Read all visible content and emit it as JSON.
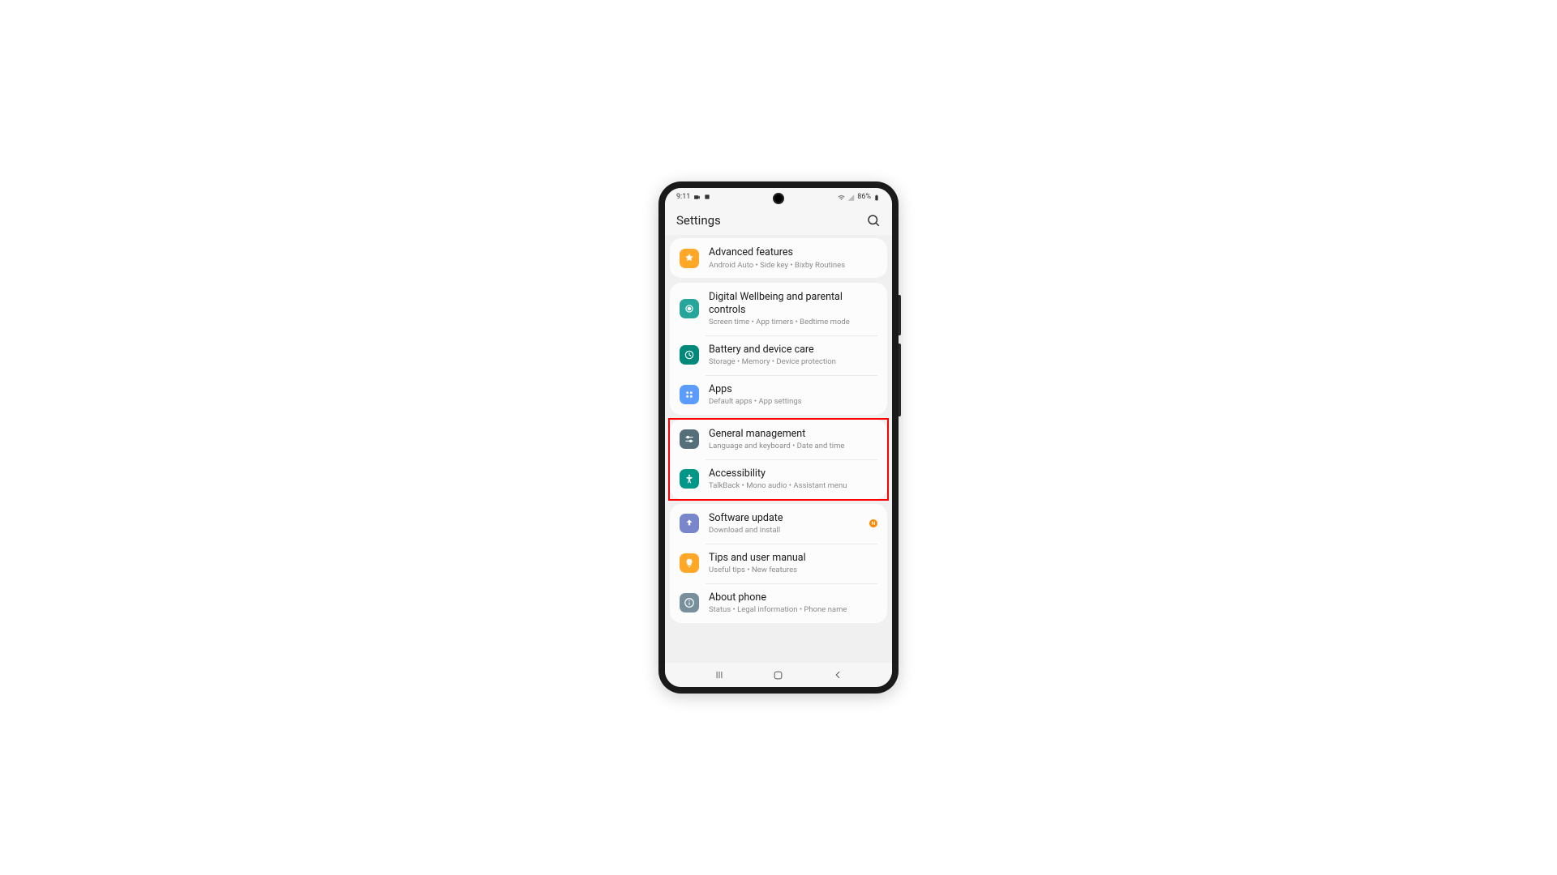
{
  "status": {
    "time": "9:11",
    "battery": "86%"
  },
  "header": {
    "title": "Settings"
  },
  "groups": [
    {
      "items": [
        {
          "icon": "advanced",
          "color": "#ffa726",
          "title": "Advanced features",
          "sub": "Android Auto  •  Side key  •  Bixby Routines"
        }
      ]
    },
    {
      "items": [
        {
          "icon": "wellbeing",
          "color": "#26a69a",
          "title": "Digital Wellbeing and parental controls",
          "sub": "Screen time  •  App timers  •  Bedtime mode"
        },
        {
          "icon": "battery",
          "color": "#00897b",
          "title": "Battery and device care",
          "sub": "Storage  •  Memory  •  Device protection"
        },
        {
          "icon": "apps",
          "color": "#5c9cff",
          "title": "Apps",
          "sub": "Default apps  •  App settings"
        }
      ]
    },
    {
      "highlight": true,
      "items": [
        {
          "icon": "general",
          "color": "#546e7a",
          "title": "General management",
          "sub": "Language and keyboard  •  Date and time"
        },
        {
          "icon": "accessibility",
          "color": "#009688",
          "title": "Accessibility",
          "sub": "TalkBack  •  Mono audio  •  Assistant menu"
        }
      ]
    },
    {
      "items": [
        {
          "icon": "update",
          "color": "#7986cb",
          "title": "Software update",
          "sub": "Download and install",
          "badge": "N"
        },
        {
          "icon": "tips",
          "color": "#ffa726",
          "title": "Tips and user manual",
          "sub": "Useful tips  •  New features"
        },
        {
          "icon": "about",
          "color": "#78909c",
          "title": "About phone",
          "sub": "Status  •  Legal information  •  Phone name"
        }
      ]
    }
  ]
}
